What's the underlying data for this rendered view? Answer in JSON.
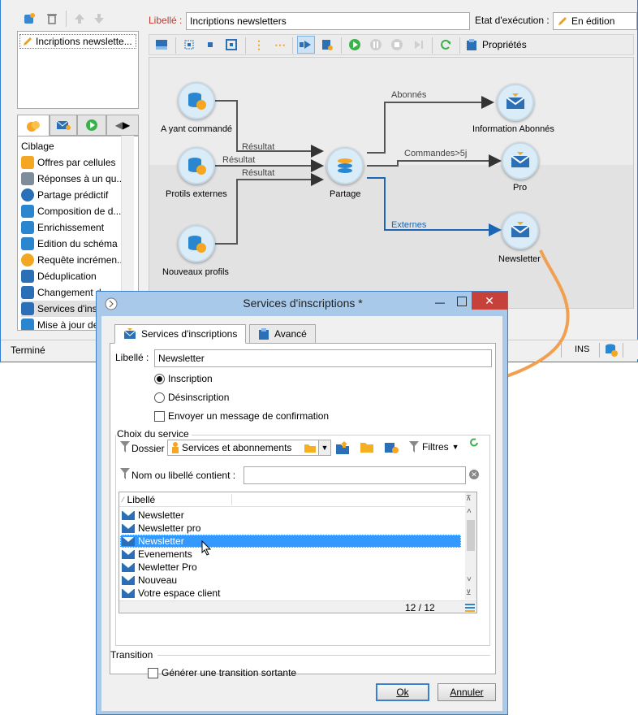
{
  "main": {
    "libelle_label": "Libellé :",
    "libelle_value": "Incriptions newsletters",
    "etat_label": "Etat d'exécution :",
    "etat_value": "En édition",
    "toolbar": {
      "properties_label": "Propriétés"
    },
    "left_list": {
      "item": "Incriptions newslette..."
    },
    "activities": {
      "header": "Ciblage",
      "items": [
        "Offres par cellules",
        "Réponses à un qu...",
        "Partage prédictif",
        "Composition de d...",
        "Enrichissement",
        "Edition du schéma",
        "Requête incrémen...",
        "Déduplication",
        "Changement d",
        "Services d'insc",
        "Mise à jour de"
      ]
    },
    "workflow": {
      "nodes": {
        "ayant": "A yant commandé",
        "protils": "Protils externes",
        "nouveaux": "Nouveaux profils",
        "partage": "Partage",
        "info": "Information Abonnés",
        "pro": "Pro",
        "newsletter": "Newsletter"
      },
      "transitions": {
        "res1": "Résultat",
        "res2": "Résultat",
        "res3": "Résultat",
        "abonnes": "Abonnés",
        "commandes": "Commandes>5j",
        "externes": "Externes"
      }
    },
    "status": {
      "text": "Terminé",
      "ins": "INS"
    }
  },
  "dialog": {
    "title": "Services d'inscriptions *",
    "tabs": [
      "Services d'inscriptions",
      "Avancé"
    ],
    "libelle_label": "Libellé :",
    "libelle_value": "Newsletter",
    "radio_inscription": "Inscription",
    "radio_desinscription": "Désinscription",
    "confirm_label": "Envoyer un message de confirmation",
    "choix_title": "Choix du service",
    "dossier_label": "Dossier :",
    "dossier_value": "Services et abonnements",
    "filtres_label": "Filtres",
    "nom_label": "Nom ou libellé contient :",
    "nom_value": "",
    "column_header": "Libellé",
    "rows": [
      "Newsletter",
      "Newsletter pro",
      "Newsletter",
      "Evenements",
      "Newletter Pro",
      "Nouveau",
      "Votre espace client"
    ],
    "selected_row": 2,
    "count": "12 / 12",
    "transition_title": "Transition",
    "transition_label": "Générer une transition sortante",
    "ok_label": "Ok",
    "cancel_label": "Annuler"
  },
  "colors": {
    "accent": "#2f7fd6",
    "arrow_orange": "#f0a050",
    "selection": "#3399ff",
    "titlebar": "#a9c9ea"
  }
}
